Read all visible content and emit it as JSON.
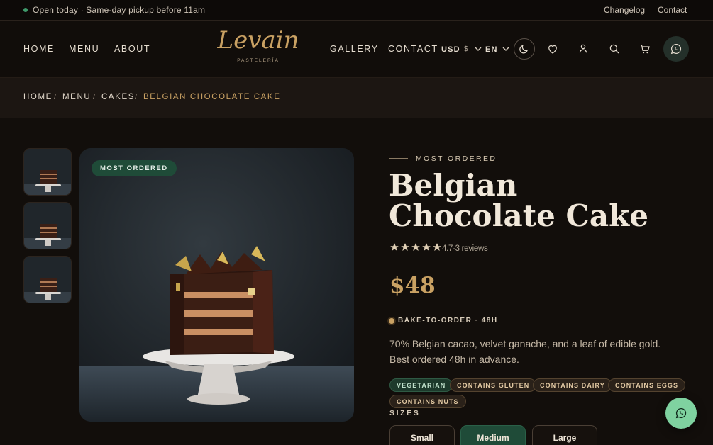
{
  "topbar": {
    "announcement": "Open today · Same-day pickup before 11am",
    "links": [
      "Changelog",
      "Contact"
    ]
  },
  "header": {
    "logo": "Levain",
    "logo_sub": "PASTELERÍA",
    "nav_left": [
      "HOME",
      "MENU",
      "ABOUT"
    ],
    "nav_right": [
      "GALLERY",
      "CONTACT"
    ],
    "currency": "USD",
    "currency_symbol": "$",
    "language": "EN",
    "icons": [
      "moon-icon",
      "heart-icon",
      "user-icon",
      "search-icon",
      "cart-icon",
      "whatsapp-icon"
    ]
  },
  "breadcrumb": {
    "items": [
      "HOME",
      "MENU",
      "CAKES"
    ],
    "current": "BELGIAN CHOCOLATE CAKE",
    "separator": "/"
  },
  "gallery": {
    "badge": "MOST ORDERED",
    "thumbnails": 3
  },
  "product": {
    "eyebrow": "MOST ORDERED",
    "title": "Belgian Chocolate Cake",
    "stars": 5,
    "rating_text": "4.7·3 reviews",
    "price": "$48",
    "bake_note": "BAKE-TO-ORDER · 48H",
    "description": "70% Belgian cacao, velvet ganache, and a leaf of edible gold. Best ordered 48h in advance.",
    "tags": [
      {
        "label": "VEGETARIAN",
        "style": "green"
      },
      {
        "label": "CONTAINS GLUTEN",
        "style": "brown"
      },
      {
        "label": "CONTAINS DAIRY",
        "style": "brown"
      },
      {
        "label": "CONTAINS EGGS",
        "style": "brown"
      },
      {
        "label": "CONTAINS NUTS",
        "style": "brown"
      }
    ],
    "sizes_label": "SIZES",
    "sizes": [
      "Small",
      "Medium",
      "Large"
    ],
    "selected_size": "Medium"
  },
  "colors": {
    "accent_gold": "#c9a163",
    "accent_green": "#1f4b38",
    "background": "#120e0b"
  }
}
